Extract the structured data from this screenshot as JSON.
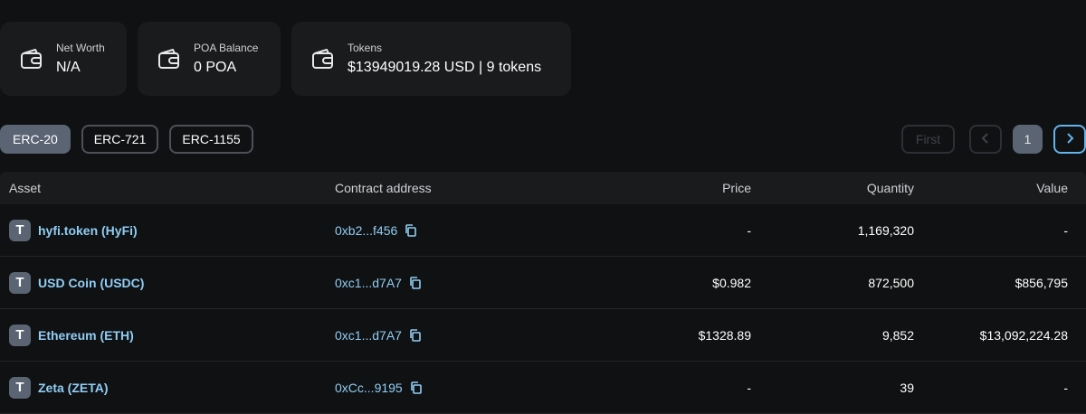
{
  "summary": {
    "net_worth_label": "Net Worth",
    "net_worth_value": "N/A",
    "balance_label": "POA Balance",
    "balance_value": "0 POA",
    "tokens_label": "Tokens",
    "tokens_value": "$13949019.28 USD | 9 tokens"
  },
  "tabs": [
    {
      "label": "ERC-20",
      "active": true
    },
    {
      "label": "ERC-721",
      "active": false
    },
    {
      "label": "ERC-1155",
      "active": false
    }
  ],
  "pagination": {
    "first_label": "First",
    "current_page": "1",
    "prev_icon": "chevron-left-icon",
    "next_icon": "chevron-right-icon"
  },
  "table": {
    "headers": {
      "asset": "Asset",
      "contract": "Contract address",
      "price": "Price",
      "quantity": "Quantity",
      "value": "Value"
    },
    "rows": [
      {
        "badge": "T",
        "asset": "hyfi.token (HyFi)",
        "contract": "0xb2...f456",
        "price": "-",
        "quantity": "1,169,320",
        "value": "-"
      },
      {
        "badge": "T",
        "asset": "USD Coin (USDC)",
        "contract": "0xc1...d7A7",
        "price": "$0.982",
        "quantity": "872,500",
        "value": "$856,795"
      },
      {
        "badge": "T",
        "asset": "Ethereum (ETH)",
        "contract": "0xc1...d7A7",
        "price": "$1328.89",
        "quantity": "9,852",
        "value": "$13,092,224.28"
      },
      {
        "badge": "T",
        "asset": "Zeta (ZETA)",
        "contract": "0xCc...9195",
        "price": "-",
        "quantity": "39",
        "value": "-"
      }
    ]
  },
  "colors": {
    "background": "#101112",
    "card": "#1a1b1d",
    "link": "#90cdf4",
    "accent": "#63b3ed",
    "active_tab": "#5a6473"
  }
}
